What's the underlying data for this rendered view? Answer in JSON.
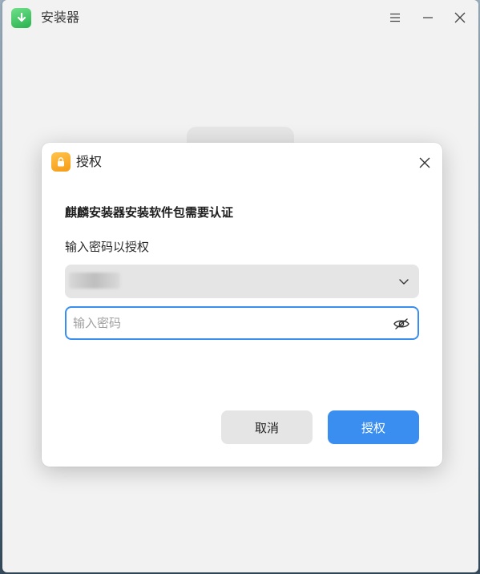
{
  "app": {
    "title": "安装器",
    "icon": "installer-download-icon",
    "accent": "#3a8ef0"
  },
  "window_controls": {
    "menu_icon": "menu-icon",
    "minimize_icon": "minimize-icon",
    "close_icon": "close-icon"
  },
  "dialog": {
    "title": "授权",
    "icon": "lock-icon",
    "heading": "麒麟安装器安装软件包需要认证",
    "subheading": "输入密码以授权",
    "user_select": {
      "value": "",
      "icon": "chevron-down-icon"
    },
    "password": {
      "placeholder": "输入密码",
      "value": "",
      "toggle_icon": "eye-hidden-icon"
    },
    "buttons": {
      "cancel": "取消",
      "authorize": "授权"
    }
  }
}
